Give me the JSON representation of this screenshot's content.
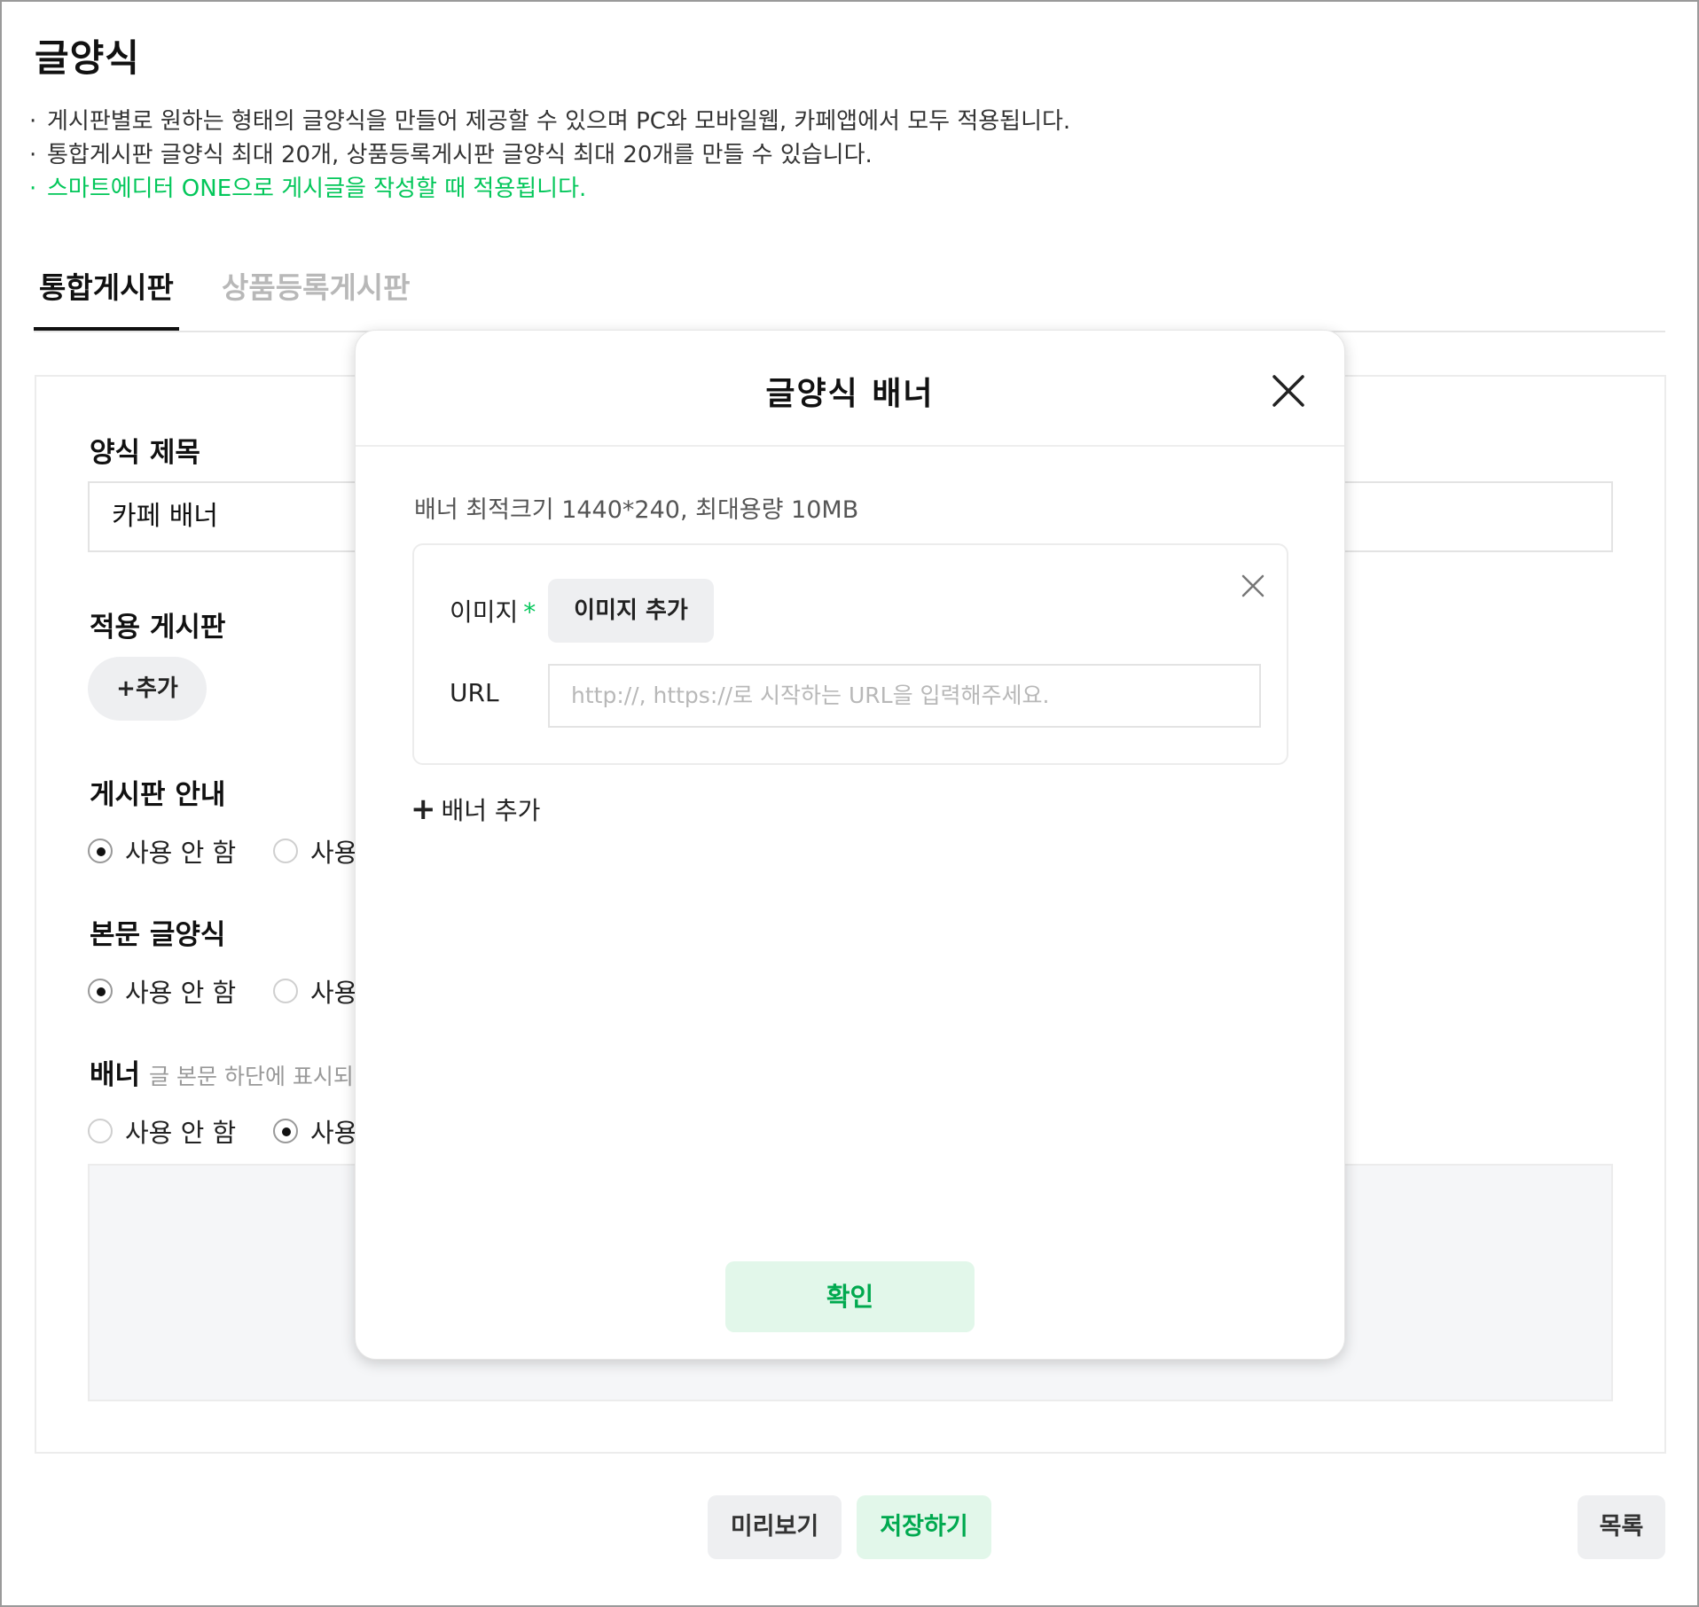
{
  "page": {
    "title": "글양식",
    "notes": [
      "게시판별로 원하는 형태의 글양식을 만들어 제공할 수 있으며 PC와 모바일웹, 카페앱에서 모두 적용됩니다.",
      "통합게시판 글양식 최대 20개, 상품등록게시판 글양식 최대 20개를 만들 수 있습니다.",
      "스마트에디터 ONE으로 게시글을 작성할 때 적용됩니다."
    ],
    "bullet": "·"
  },
  "tabs": [
    {
      "label": "통합게시판",
      "active": true
    },
    {
      "label": "상품등록게시판",
      "active": false
    }
  ],
  "form": {
    "title_label": "양식 제목",
    "title_value": "카페 배너",
    "board_label": "적용 게시판",
    "board_add": "+추가",
    "guide_label": "게시판 안내",
    "guide_opt_off": "사용 안 함",
    "guide_opt_on": "사용",
    "body_label": "본문 글양식",
    "body_opt_off": "사용 안 함",
    "body_opt_on": "사용",
    "banner_label": "배너",
    "banner_sub": "글 본문 하단에 표시되",
    "banner_opt_off": "사용 안 함",
    "banner_opt_on": "사용"
  },
  "footer": {
    "preview": "미리보기",
    "save": "저장하기",
    "list": "목록"
  },
  "modal": {
    "title": "글양식 배너",
    "hint": "배너 최적크기 1440*240, 최대용량 10MB",
    "image_label": "이미지",
    "required_mark": "*",
    "image_add": "이미지 추가",
    "url_label": "URL",
    "url_placeholder": "http://, https://로 시작하는 URL을 입력해주세요.",
    "add_banner": "배너 추가",
    "plus": "+",
    "confirm": "확인"
  },
  "colors": {
    "accent_green": "#03c75a",
    "button_green_bg": "#e2f7ea",
    "button_gray_bg": "#eeeff1"
  },
  "icons": {
    "modal_close": "close-icon",
    "box_close": "close-icon",
    "add_banner": "plus-icon"
  }
}
